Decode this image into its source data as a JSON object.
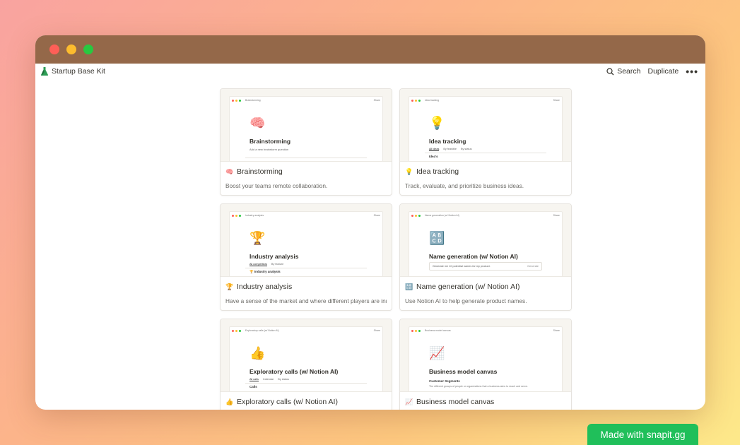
{
  "window": {
    "title": "Startup Base Kit"
  },
  "topbar": {
    "search_label": "Search",
    "duplicate_label": "Duplicate",
    "more_label": "•••"
  },
  "cards": [
    {
      "icon": "🧠",
      "title": "Brainstorming",
      "description": "Boost your teams remote collaboration.",
      "preview": {
        "crumb": "Brainstorming",
        "share": "Share",
        "subtitle": "Add a new brainstorm question"
      }
    },
    {
      "icon": "💡",
      "title": "Idea tracking",
      "description": "Track, evaluate, and prioritize business ideas.",
      "preview": {
        "crumb": "Idea tracking",
        "share": "Share",
        "tabs": [
          "All ideas",
          "By feasible",
          "By status"
        ],
        "section": "Idea's"
      }
    },
    {
      "icon": "🏆",
      "title": "Industry analysis",
      "description": "Have a sense of the market and where different players are innovating.",
      "preview": {
        "crumb": "Industry analysis",
        "share": "Share",
        "tabs": [
          "All competitors",
          "By feature"
        ],
        "section": "🏆 Industry analysis"
      }
    },
    {
      "icon": "🔠",
      "title": "Name generation (w/ Notion AI)",
      "description": "Use Notion AI to help generate product names.",
      "preview": {
        "crumb": "Name generation (w/ Notion AI)",
        "share": "Share",
        "input": "Generate me 10 potential names for my product.",
        "input_btn": "Generate"
      }
    },
    {
      "icon": "👍",
      "title": "Exploratory calls (w/ Notion AI)",
      "description": "",
      "preview": {
        "crumb": "Exploratory calls (w/ Notion AI)",
        "share": "Share",
        "tabs": [
          "All calls",
          "Calendar",
          "By status"
        ],
        "section": "Calls"
      }
    },
    {
      "icon": "📈",
      "title": "Business model canvas",
      "description": "",
      "preview": {
        "crumb": "Business model canvas",
        "share": "Share",
        "section": "Customer Segments",
        "text": "The different groups of people or organizations that a business aims to reach and serve."
      }
    }
  ],
  "footer": {
    "badge": "Made with snapit.gg"
  },
  "colors": {
    "titlebar": "#946849",
    "badge": "#20bf5a"
  }
}
